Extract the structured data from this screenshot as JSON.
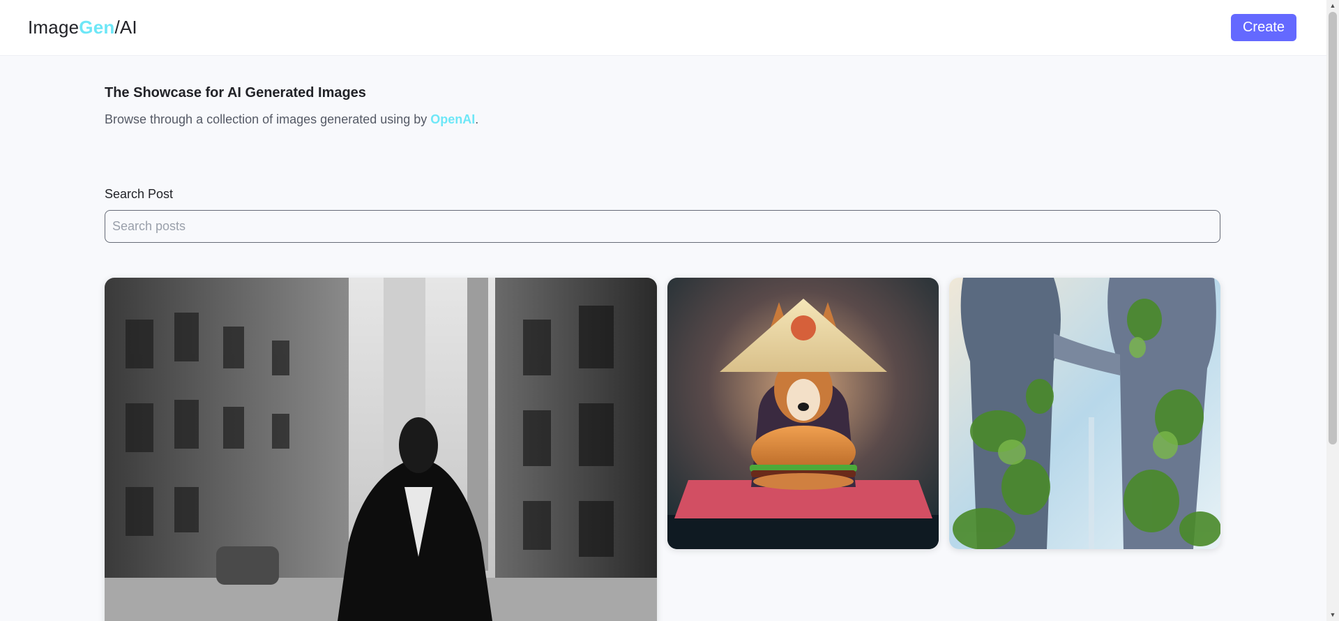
{
  "header": {
    "logo_part1": "Image",
    "logo_part2": "Gen",
    "logo_part3": "/AI",
    "create_label": "Create"
  },
  "intro": {
    "title": "The Showcase for AI Generated Images",
    "subtitle_prefix": "Browse through a collection of images generated using by ",
    "subtitle_link": "OpenAI",
    "subtitle_suffix": "."
  },
  "search": {
    "label": "Search Post",
    "placeholder": "Search posts",
    "value": ""
  },
  "gallery": {
    "images": [
      {
        "name": "black-white-street-image"
      },
      {
        "name": "shiba-burger-image"
      },
      {
        "name": "overgrown-towers-image"
      }
    ]
  },
  "colors": {
    "accent": "#6469ff",
    "brand_cyan": "#6ee7f7",
    "background": "#f8f9fc"
  }
}
